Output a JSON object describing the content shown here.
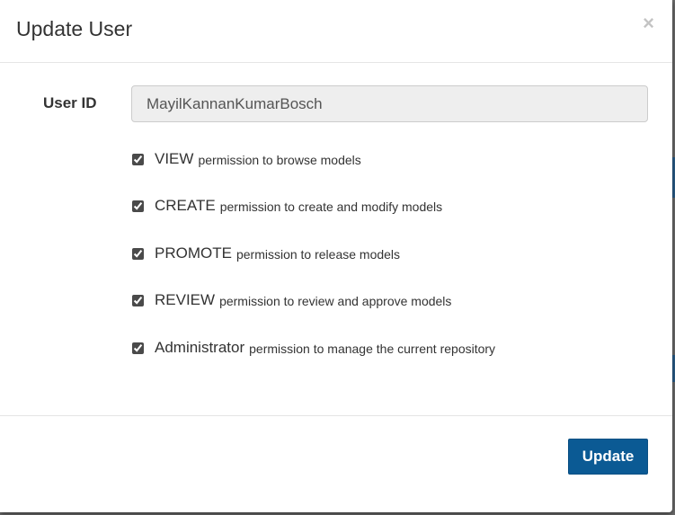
{
  "dialog": {
    "title": "Update User",
    "close_label": "×"
  },
  "form": {
    "user_id_label": "User ID",
    "user_id_value": "MayilKannanKumarBosch"
  },
  "permissions": [
    {
      "name": "VIEW",
      "description": "permission to browse models",
      "checked": true
    },
    {
      "name": "CREATE",
      "description": "permission to create and modify models",
      "checked": true
    },
    {
      "name": "PROMOTE",
      "description": "permission to release models",
      "checked": true
    },
    {
      "name": "REVIEW",
      "description": "permission to review and approve models",
      "checked": true
    },
    {
      "name": "Administrator",
      "description": "permission to manage the current repository",
      "checked": true
    }
  ],
  "footer": {
    "update_label": "Update"
  },
  "colors": {
    "primary_button": "#0b5a94",
    "input_disabled_bg": "#eeeeee"
  }
}
